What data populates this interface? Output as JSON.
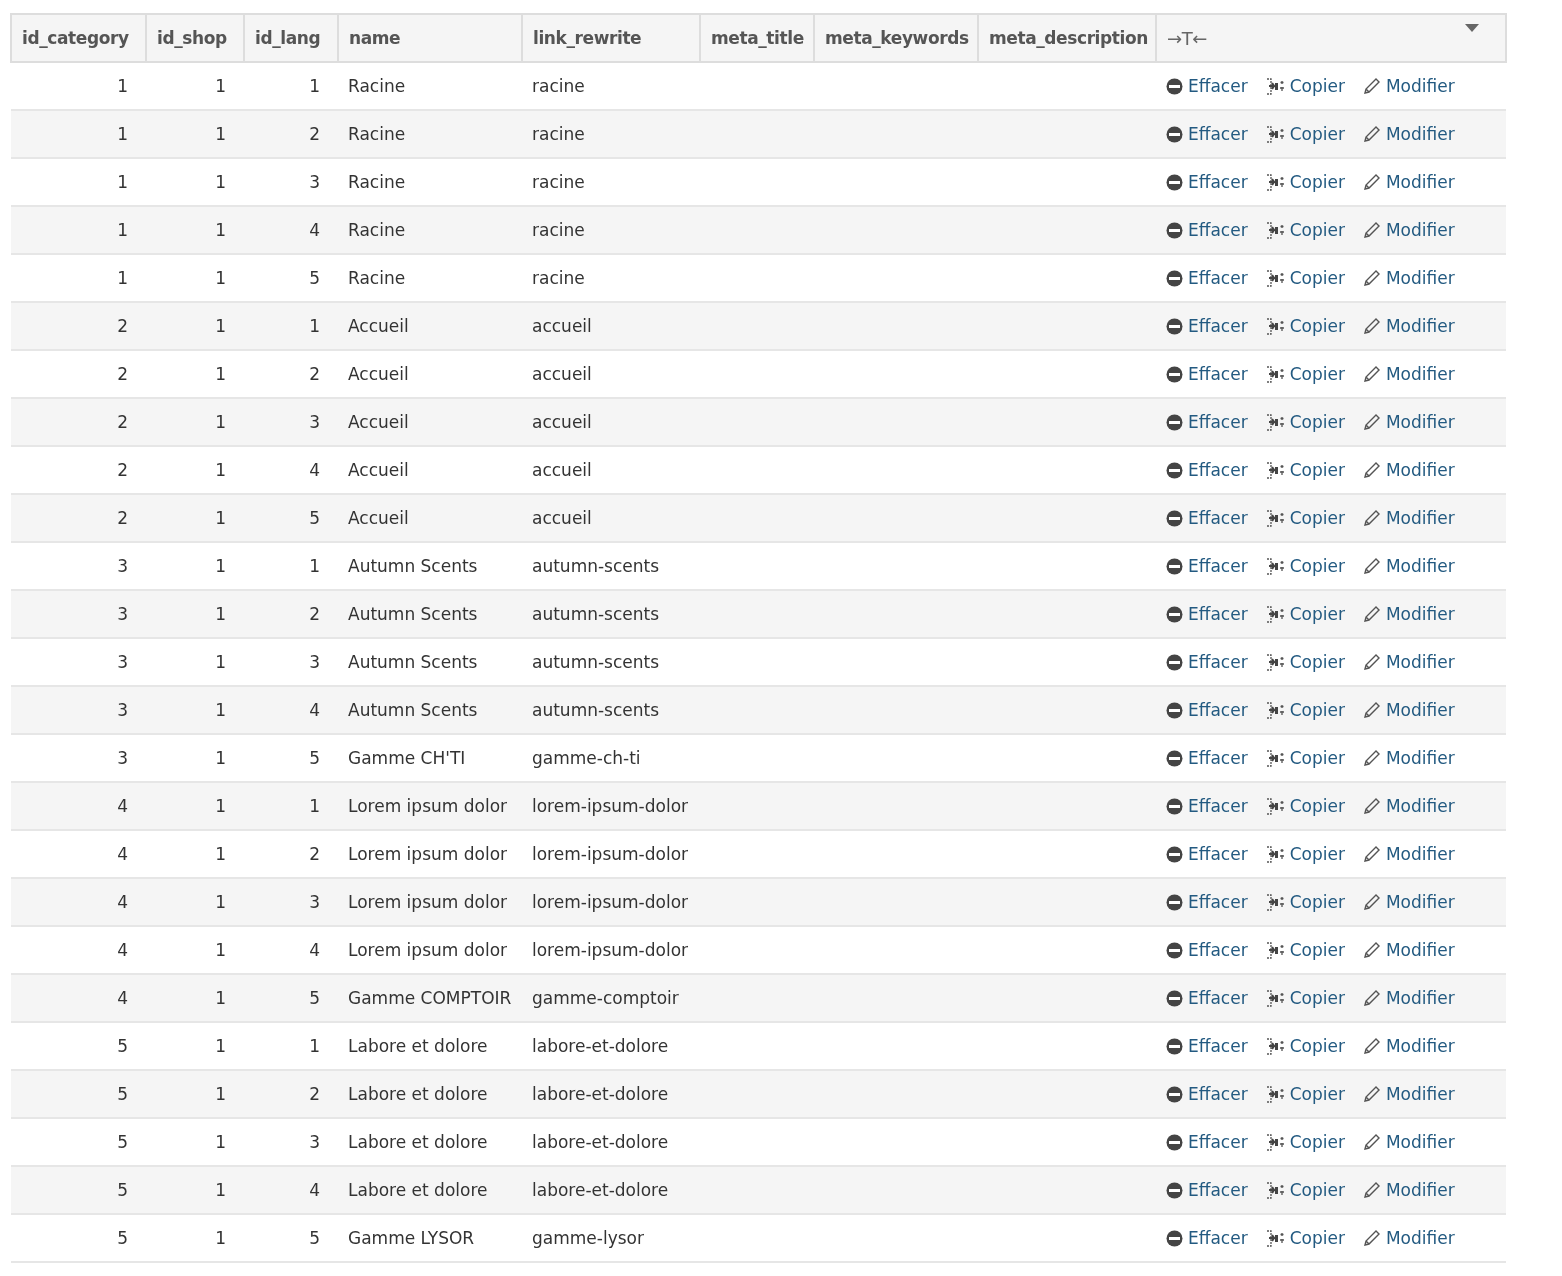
{
  "table": {
    "columns": [
      "id_category",
      "id_shop",
      "id_lang",
      "name",
      "link_rewrite",
      "meta_title",
      "meta_keywords",
      "meta_description"
    ],
    "toggle_label": "→T←",
    "rows": [
      {
        "cells": [
          "1",
          "1",
          "1",
          "Racine",
          "racine"
        ],
        "actions": [
          {
            "kind": "delete",
            "label": "Effacer"
          },
          {
            "kind": "copy",
            "label": "Copier"
          },
          {
            "kind": "edit",
            "label": "Modifier"
          }
        ]
      },
      {
        "cells": [
          "1",
          "1",
          "2",
          "Racine",
          "racine"
        ],
        "actions": [
          {
            "kind": "delete",
            "label": "Effacer"
          },
          {
            "kind": "copy",
            "label": "Copier"
          },
          {
            "kind": "edit",
            "label": "Modifier"
          }
        ]
      },
      {
        "cells": [
          "1",
          "1",
          "3",
          "Racine",
          "racine"
        ],
        "actions": [
          {
            "kind": "delete",
            "label": "Effacer"
          },
          {
            "kind": "copy",
            "label": "Copier"
          },
          {
            "kind": "edit",
            "label": "Modifier"
          }
        ]
      },
      {
        "cells": [
          "1",
          "1",
          "4",
          "Racine",
          "racine"
        ],
        "actions": [
          {
            "kind": "delete",
            "label": "Effacer"
          },
          {
            "kind": "copy",
            "label": "Copier"
          },
          {
            "kind": "edit",
            "label": "Modifier"
          }
        ]
      },
      {
        "cells": [
          "1",
          "1",
          "5",
          "Racine",
          "racine"
        ],
        "actions": [
          {
            "kind": "delete",
            "label": "Effacer"
          },
          {
            "kind": "copy",
            "label": "Copier"
          },
          {
            "kind": "edit",
            "label": "Modifier"
          }
        ]
      },
      {
        "cells": [
          "2",
          "1",
          "1",
          "Accueil",
          "accueil"
        ],
        "actions": [
          {
            "kind": "delete",
            "label": "Effacer"
          },
          {
            "kind": "copy",
            "label": "Copier"
          },
          {
            "kind": "edit",
            "label": "Modifier"
          }
        ]
      },
      {
        "cells": [
          "2",
          "1",
          "2",
          "Accueil",
          "accueil"
        ],
        "actions": [
          {
            "kind": "delete",
            "label": "Effacer"
          },
          {
            "kind": "copy",
            "label": "Copier"
          },
          {
            "kind": "edit",
            "label": "Modifier"
          }
        ]
      },
      {
        "cells": [
          "2",
          "1",
          "3",
          "Accueil",
          "accueil"
        ],
        "actions": [
          {
            "kind": "delete",
            "label": "Effacer"
          },
          {
            "kind": "copy",
            "label": "Copier"
          },
          {
            "kind": "edit",
            "label": "Modifier"
          }
        ]
      },
      {
        "cells": [
          "2",
          "1",
          "4",
          "Accueil",
          "accueil"
        ],
        "actions": [
          {
            "kind": "delete",
            "label": "Effacer"
          },
          {
            "kind": "copy",
            "label": "Copier"
          },
          {
            "kind": "edit",
            "label": "Modifier"
          }
        ]
      },
      {
        "cells": [
          "2",
          "1",
          "5",
          "Accueil",
          "accueil"
        ],
        "actions": [
          {
            "kind": "delete",
            "label": "Effacer"
          },
          {
            "kind": "copy",
            "label": "Copier"
          },
          {
            "kind": "edit",
            "label": "Modifier"
          }
        ]
      },
      {
        "cells": [
          "3",
          "1",
          "1",
          "Autumn Scents",
          "autumn-scents"
        ],
        "actions": [
          {
            "kind": "delete",
            "label": "Effacer"
          },
          {
            "kind": "copy",
            "label": "Copier"
          },
          {
            "kind": "edit",
            "label": "Modifier"
          }
        ]
      },
      {
        "cells": [
          "3",
          "1",
          "2",
          "Autumn Scents",
          "autumn-scents"
        ],
        "actions": [
          {
            "kind": "delete",
            "label": "Effacer"
          },
          {
            "kind": "copy",
            "label": "Copier"
          },
          {
            "kind": "edit",
            "label": "Modifier"
          }
        ]
      },
      {
        "cells": [
          "3",
          "1",
          "3",
          "Autumn Scents",
          "autumn-scents"
        ],
        "actions": [
          {
            "kind": "delete",
            "label": "Effacer"
          },
          {
            "kind": "copy",
            "label": "Copier"
          },
          {
            "kind": "edit",
            "label": "Modifier"
          }
        ]
      },
      {
        "cells": [
          "3",
          "1",
          "4",
          "Autumn Scents",
          "autumn-scents"
        ],
        "actions": [
          {
            "kind": "delete",
            "label": "Effacer"
          },
          {
            "kind": "copy",
            "label": "Copier"
          },
          {
            "kind": "edit",
            "label": "Modifier"
          }
        ]
      },
      {
        "cells": [
          "3",
          "1",
          "5",
          "Gamme CH'TI",
          "gamme-ch-ti"
        ],
        "actions": [
          {
            "kind": "delete",
            "label": "Effacer"
          },
          {
            "kind": "copy",
            "label": "Copier"
          },
          {
            "kind": "edit",
            "label": "Modifier"
          }
        ]
      },
      {
        "cells": [
          "4",
          "1",
          "1",
          "Lorem ipsum dolor",
          "lorem-ipsum-dolor"
        ],
        "actions": [
          {
            "kind": "delete",
            "label": "Effacer"
          },
          {
            "kind": "copy",
            "label": "Copier"
          },
          {
            "kind": "edit",
            "label": "Modifier"
          }
        ]
      },
      {
        "cells": [
          "4",
          "1",
          "2",
          "Lorem ipsum dolor",
          "lorem-ipsum-dolor"
        ],
        "actions": [
          {
            "kind": "delete",
            "label": "Effacer"
          },
          {
            "kind": "copy",
            "label": "Copier"
          },
          {
            "kind": "edit",
            "label": "Modifier"
          }
        ]
      },
      {
        "cells": [
          "4",
          "1",
          "3",
          "Lorem ipsum dolor",
          "lorem-ipsum-dolor"
        ],
        "actions": [
          {
            "kind": "delete",
            "label": "Effacer"
          },
          {
            "kind": "copy",
            "label": "Copier"
          },
          {
            "kind": "edit",
            "label": "Modifier"
          }
        ]
      },
      {
        "cells": [
          "4",
          "1",
          "4",
          "Lorem ipsum dolor",
          "lorem-ipsum-dolor"
        ],
        "actions": [
          {
            "kind": "delete",
            "label": "Effacer"
          },
          {
            "kind": "copy",
            "label": "Copier"
          },
          {
            "kind": "edit",
            "label": "Modifier"
          }
        ]
      },
      {
        "cells": [
          "4",
          "1",
          "5",
          "Gamme COMPTOIR",
          "gamme-comptoir"
        ],
        "actions": [
          {
            "kind": "delete",
            "label": "Effacer"
          },
          {
            "kind": "copy",
            "label": "Copier"
          },
          {
            "kind": "edit",
            "label": "Modifier"
          }
        ]
      },
      {
        "cells": [
          "5",
          "1",
          "1",
          "Labore et dolore",
          "labore-et-dolore"
        ],
        "actions": [
          {
            "kind": "delete",
            "label": "Effacer"
          },
          {
            "kind": "copy",
            "label": "Copier"
          },
          {
            "kind": "edit",
            "label": "Modifier"
          }
        ]
      },
      {
        "cells": [
          "5",
          "1",
          "2",
          "Labore et dolore",
          "labore-et-dolore"
        ],
        "actions": [
          {
            "kind": "delete",
            "label": "Effacer"
          },
          {
            "kind": "copy",
            "label": "Copier"
          },
          {
            "kind": "edit",
            "label": "Modifier"
          }
        ]
      },
      {
        "cells": [
          "5",
          "1",
          "3",
          "Labore et dolore",
          "labore-et-dolore"
        ],
        "actions": [
          {
            "kind": "delete",
            "label": "Effacer"
          },
          {
            "kind": "copy",
            "label": "Copier"
          },
          {
            "kind": "edit",
            "label": "Modifier"
          }
        ]
      },
      {
        "cells": [
          "5",
          "1",
          "4",
          "Labore et dolore",
          "labore-et-dolore"
        ],
        "actions": [
          {
            "kind": "delete",
            "label": "Effacer"
          },
          {
            "kind": "copy",
            "label": "Copier"
          },
          {
            "kind": "edit",
            "label": "Modifier"
          }
        ]
      },
      {
        "cells": [
          "5",
          "1",
          "5",
          "Gamme LYSOR",
          "gamme-lysor"
        ],
        "actions": [
          {
            "kind": "delete",
            "label": "Effacer"
          },
          {
            "kind": "copy",
            "label": "Copier"
          },
          {
            "kind": "edit",
            "label": "Modifier"
          }
        ]
      }
    ]
  }
}
